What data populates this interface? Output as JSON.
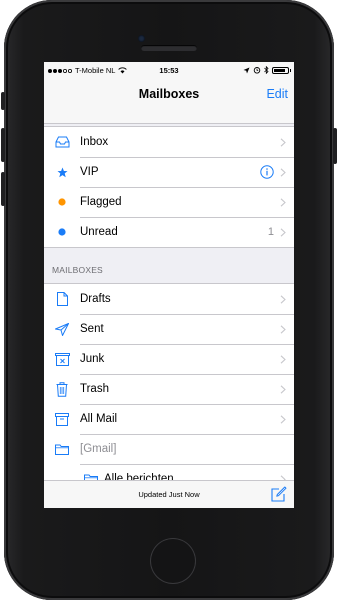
{
  "status_bar": {
    "carrier": "T-Mobile NL",
    "time": "15:53"
  },
  "nav": {
    "title": "Mailboxes",
    "edit_label": "Edit"
  },
  "top_mailboxes": [
    {
      "label": "Inbox",
      "icon": "inbox-icon"
    },
    {
      "label": "VIP",
      "icon": "star-icon"
    },
    {
      "label": "Flagged",
      "icon": "orange-dot-icon"
    },
    {
      "label": "Unread",
      "icon": "blue-dot-icon",
      "count": "1"
    }
  ],
  "section": {
    "header": "MAILBOXES"
  },
  "mailboxes": [
    {
      "label": "Drafts",
      "icon": "document-icon"
    },
    {
      "label": "Sent",
      "icon": "paper-plane-icon"
    },
    {
      "label": "Junk",
      "icon": "junk-tray-icon"
    },
    {
      "label": "Trash",
      "icon": "trash-icon"
    },
    {
      "label": "All Mail",
      "icon": "archive-box-icon"
    },
    {
      "label": "[Gmail]",
      "icon": "folder-icon"
    },
    {
      "label": "Alle berichten",
      "icon": "folder-icon"
    }
  ],
  "toolbar": {
    "status": "Updated Just Now",
    "compose_icon": "compose-icon"
  },
  "colors": {
    "accent": "#1a7cf7",
    "flag": "#ff9500",
    "background": "#efeff4"
  }
}
